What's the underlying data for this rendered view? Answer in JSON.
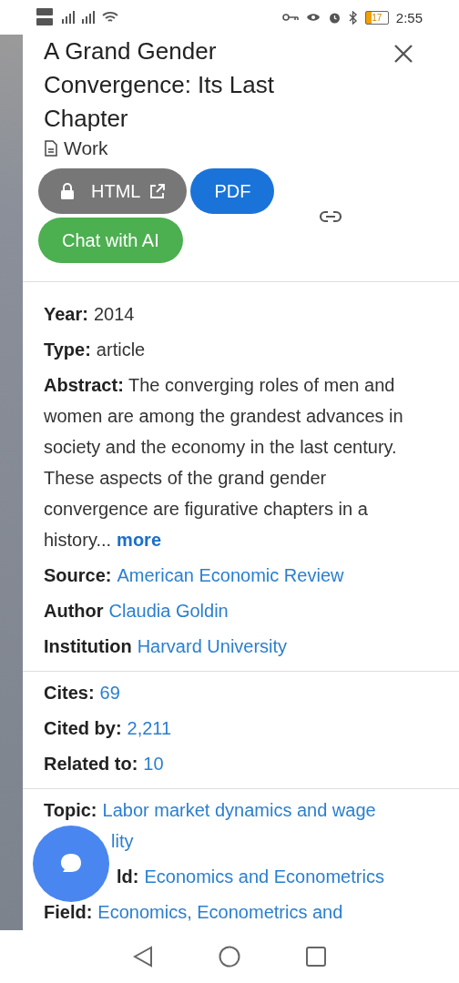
{
  "status_bar": {
    "time": "2:55",
    "battery": "17"
  },
  "paper": {
    "title": "A Grand Gender Convergence: Its Last Chapter",
    "type_label": "Work"
  },
  "buttons": [
    {
      "label": "HTML",
      "kind": "locked"
    },
    {
      "label": "PDF",
      "kind": "primary"
    },
    {
      "label": "Chat with AI",
      "kind": "chat"
    }
  ],
  "sections": [
    {
      "rows": [
        {
          "label": "Year:",
          "value": "2014",
          "link": false
        },
        {
          "label": "Type:",
          "value": "article",
          "link": false
        },
        {
          "label": "Abstract:",
          "value": "The converging roles of men and women are among the grandest advances in society and the economy in the last century. These aspects of the grand gender convergence are figurative chapters in a history...",
          "link": false,
          "more": "more"
        },
        {
          "label": "Source:",
          "value": "American Economic Review",
          "link": true
        },
        {
          "label": "Author",
          "value": "Claudia Goldin",
          "link": true
        },
        {
          "label": "Institution",
          "value": "Harvard University",
          "link": true
        }
      ]
    },
    {
      "rows": [
        {
          "label": "Cites:",
          "value": "69",
          "link": true
        },
        {
          "label": "Cited by:",
          "value": "2,211",
          "link": true
        },
        {
          "label": "Related to:",
          "value": "10",
          "link": true
        }
      ]
    },
    {
      "rows": [
        {
          "label": "Topic:",
          "value": "Labor market dynamics and wage",
          "link": true,
          "continued": "lity"
        },
        {
          "label": "ld:",
          "value": "Economics and Econometrics",
          "link": true,
          "partial": true
        },
        {
          "label": "Field:",
          "value": "Economics, Econometrics and",
          "link": true
        }
      ]
    }
  ]
}
